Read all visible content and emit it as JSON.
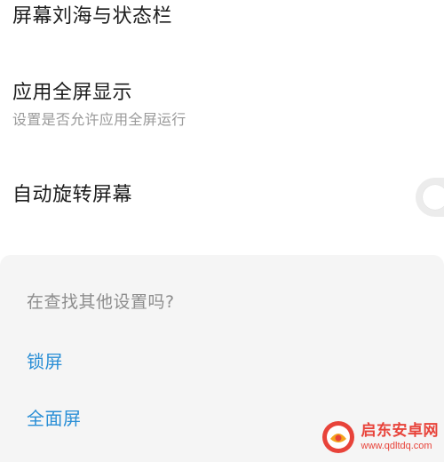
{
  "settings": {
    "notch_title": "屏幕刘海与状态栏",
    "fullscreen_apps_title": "应用全屏显示",
    "fullscreen_apps_subtitle": "设置是否允许应用全屏运行",
    "auto_rotate_title": "自动旋转屏幕",
    "auto_rotate_enabled": false
  },
  "suggestions": {
    "heading": "在查找其他设置吗?",
    "links": [
      "锁屏",
      "全面屏"
    ]
  },
  "watermark": {
    "name": "启东安卓网",
    "url": "www.qdltdq.com"
  },
  "colors": {
    "link": "#2a8fd6",
    "panel_background": "#f5f5f5",
    "watermark": "#e8433a"
  }
}
